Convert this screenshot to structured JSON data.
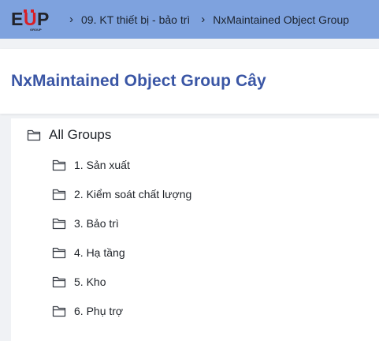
{
  "header": {
    "logo_text": "EUP",
    "logo_subtext": "GROUP",
    "breadcrumbs": [
      {
        "label": "09. KT thiết bị - bảo trì"
      },
      {
        "label": "NxMaintained Object Group"
      }
    ],
    "separator": "›",
    "colors": {
      "bar": "#7ea2de",
      "logo_red": "#d81f26",
      "logo_dark": "#22232a"
    }
  },
  "page": {
    "title": "NxMaintained Object Group Cây",
    "title_color": "#3a56a5"
  },
  "tree": {
    "root": {
      "label": "All Groups",
      "icon": "folder-open-icon"
    },
    "items": [
      {
        "label": "1. Sản xuất",
        "icon": "folder-icon"
      },
      {
        "label": "2. Kiểm soát chất lượng",
        "icon": "folder-icon"
      },
      {
        "label": "3. Bảo trì",
        "icon": "folder-icon"
      },
      {
        "label": "4. Hạ tầng",
        "icon": "folder-icon"
      },
      {
        "label": "5. Kho",
        "icon": "folder-icon"
      },
      {
        "label": "6. Phụ trợ",
        "icon": "folder-icon"
      }
    ]
  }
}
